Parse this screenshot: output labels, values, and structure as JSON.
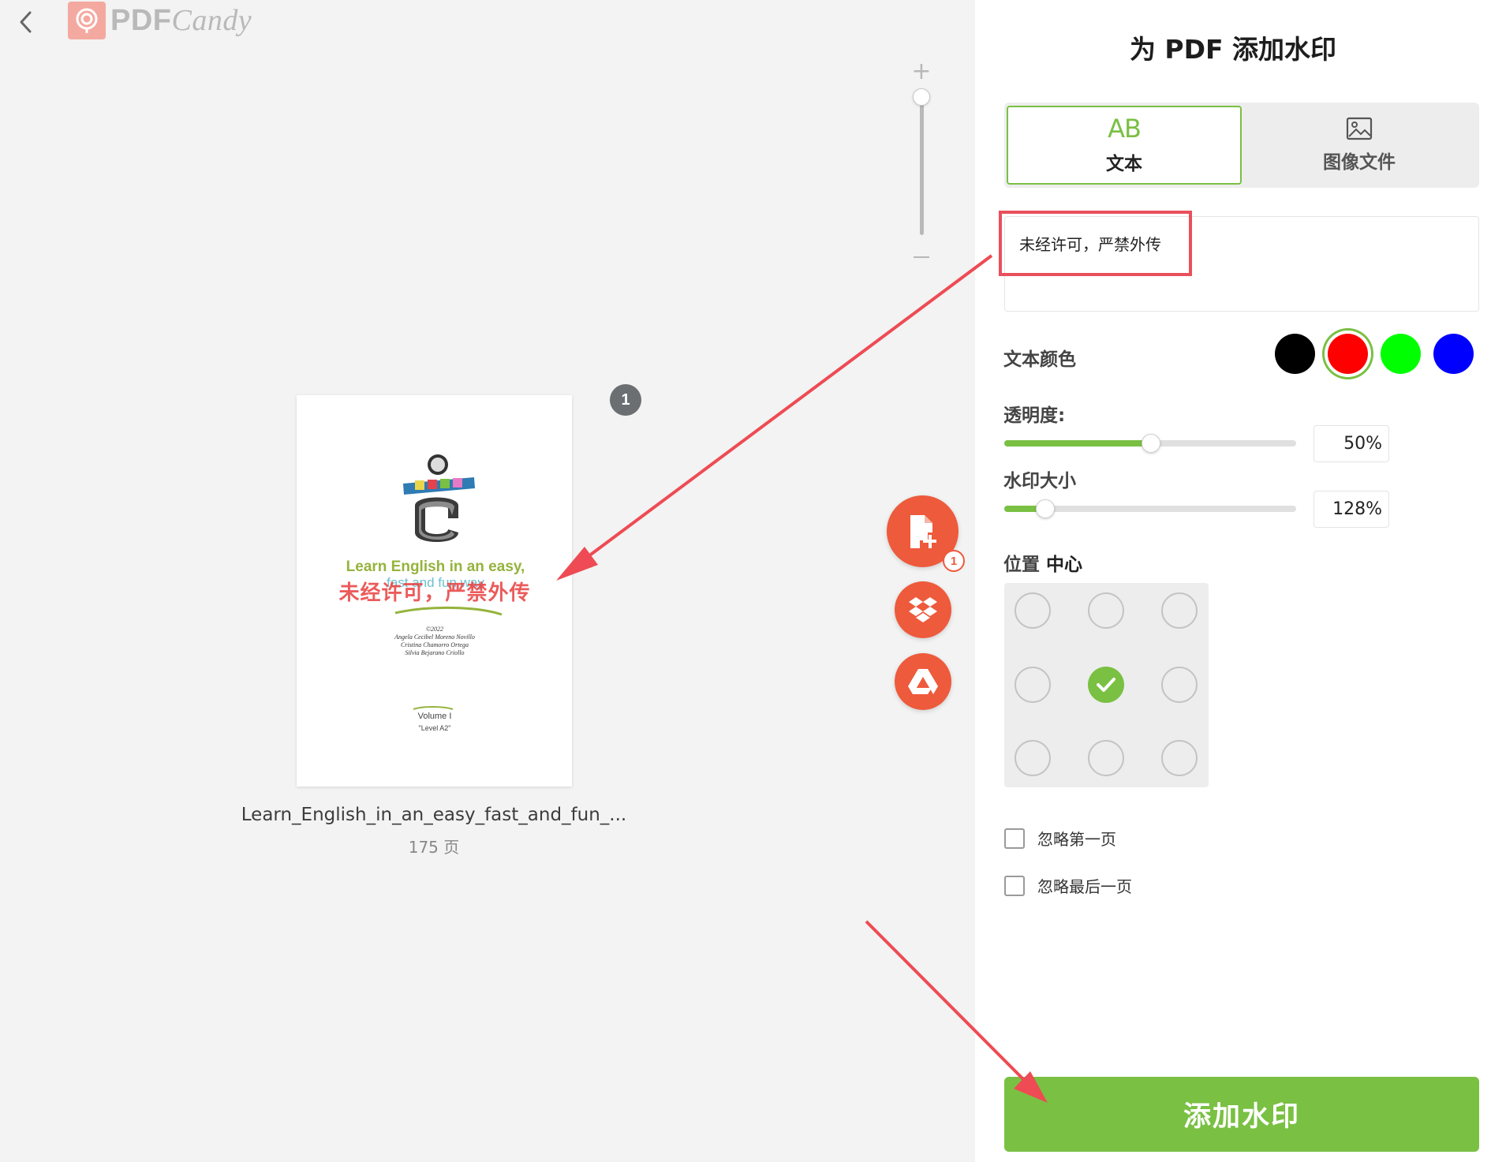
{
  "app": {
    "logo_primary": "PDF",
    "logo_secondary": "Candy"
  },
  "document": {
    "page_badge": "1",
    "file_name": "Learn_English_in_an_easy_fast_and_fun_...",
    "page_count": "175 页",
    "thumb_title": "Learn English in an easy,",
    "thumb_subtitle": "fast and fun way",
    "thumb_watermark": "未经许可，严禁外传",
    "thumb_credits": [
      "©2022",
      "Angela Cecibel Moreno Novillo",
      "Cristina Chamorro Ortega",
      "Silvia Bejarano Criollo"
    ],
    "thumb_volume": "Volume I",
    "thumb_level": "\"Level A2\""
  },
  "actions": {
    "file_count": "1"
  },
  "panel": {
    "title": "为 PDF 添加水印",
    "tabs": [
      {
        "label": "文本",
        "icon": "text-ab-icon",
        "active": true
      },
      {
        "label": "图像文件",
        "icon": "image-icon",
        "active": false
      }
    ],
    "watermark_text": "未经许可，严禁外传",
    "text_color_label": "文本颜色",
    "colors": [
      {
        "name": "black",
        "hex": "#000000",
        "selected": false
      },
      {
        "name": "red",
        "hex": "#ff0000",
        "selected": true
      },
      {
        "name": "green",
        "hex": "#00ff00",
        "selected": false
      },
      {
        "name": "blue",
        "hex": "#0000ff",
        "selected": false
      }
    ],
    "opacity_label": "透明度:",
    "opacity_value": "50%",
    "opacity_fraction": 0.5,
    "size_label": "水印大小",
    "size_value": "128%",
    "size_fraction": 0.14,
    "position_label": "位置",
    "position_value": "中心",
    "position_selected": "middle-center",
    "skip_first_label": "忽略第一页",
    "skip_last_label": "忽略最后一页",
    "submit_label": "添加水印",
    "accent_color": "#7ac043"
  }
}
